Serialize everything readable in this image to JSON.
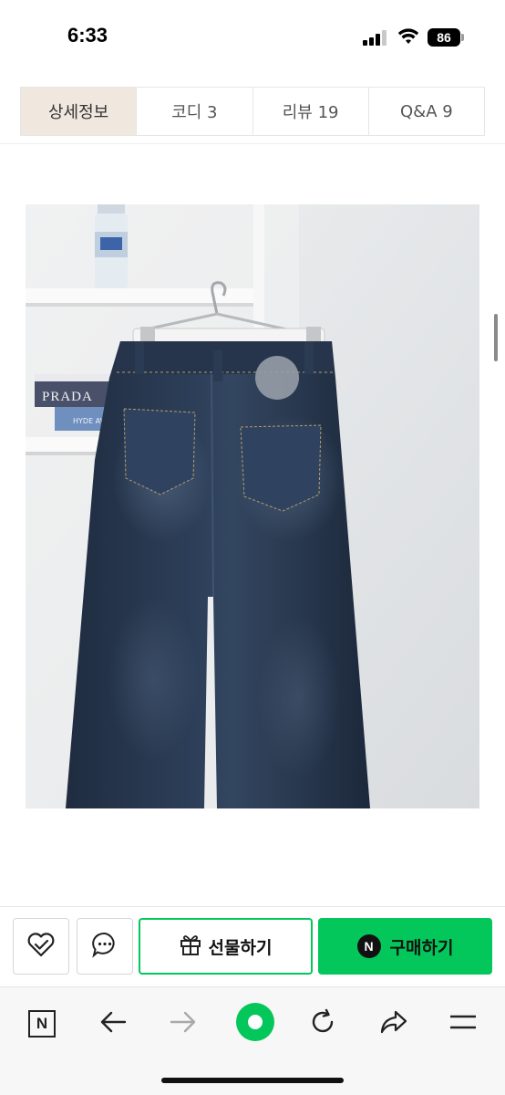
{
  "status_bar": {
    "time": "6:33",
    "battery": "86"
  },
  "tabs": [
    {
      "label": "상세정보",
      "active": true
    },
    {
      "label": "코디  3",
      "active": false
    },
    {
      "label": "리뷰  19",
      "active": false
    },
    {
      "label": "Q&A  9",
      "active": false
    }
  ],
  "product_image": {
    "book_label_1": "PRADA",
    "book_label_2": "HYDE AVE"
  },
  "actions": {
    "gift_label": "선물하기",
    "buy_badge": "N",
    "buy_label": "구매하기"
  },
  "browser_toolbar": {
    "tab_icon_letter": "N"
  },
  "colors": {
    "accent_green": "#03c75a",
    "active_tab_bg": "#f0e8df"
  }
}
